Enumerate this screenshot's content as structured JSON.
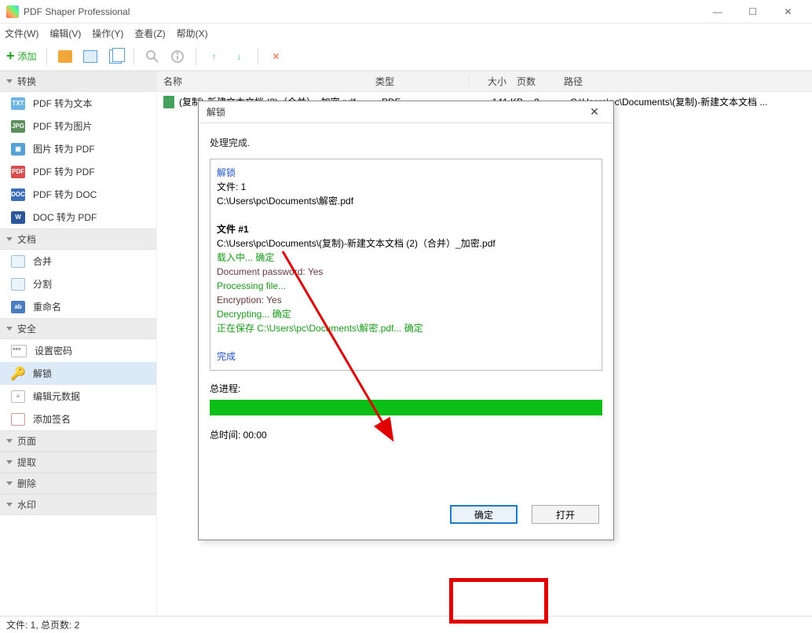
{
  "app": {
    "title": "PDF Shaper Professional"
  },
  "window": {
    "min": "—",
    "max": "☐",
    "close": "✕"
  },
  "menu": {
    "file": "文件(W)",
    "edit": "编辑(V)",
    "action": "操作(Y)",
    "view": "查看(Z)",
    "help": "帮助(X)"
  },
  "toolbar": {
    "add": "添加"
  },
  "sidebar": {
    "groups": {
      "convert": "转换",
      "document": "文档",
      "security": "安全",
      "page": "页面",
      "extract": "提取",
      "delete": "删除",
      "watermark": "水印"
    },
    "convert_items": [
      "PDF 转为文本",
      "PDF 转为图片",
      "图片 转为 PDF",
      "PDF 转为 PDF",
      "PDF 转为 DOC",
      "DOC 转为 PDF"
    ],
    "document_items": [
      "合并",
      "分割",
      "重命名"
    ],
    "security_items": [
      "设置密码",
      "解锁",
      "编辑元数据",
      "添加签名"
    ]
  },
  "columns": {
    "name": "名称",
    "type": "类型",
    "size": "大小",
    "pages": "页数",
    "path": "路径"
  },
  "row": {
    "name": "(复制)-新建文本文档 (2)（合并）_加密.pdf",
    "type": "PDF",
    "size": "141 KB",
    "pages": "2",
    "path": "C:\\Users\\pc\\Documents\\(复制)-新建文本文档 ..."
  },
  "dialog": {
    "title": "解锁",
    "done": "处理完成.",
    "l1": "解锁",
    "l2": "文件: 1",
    "l3": "C:\\Users\\pc\\Documents\\解密.pdf",
    "l4": "文件 #1",
    "l5": "C:\\Users\\pc\\Documents\\(复制)-新建文本文档 (2)（合并）_加密.pdf",
    "l6": "载入中... 确定",
    "l7": "Document password: Yes",
    "l8": "Processing file...",
    "l9": "Encryption: Yes",
    "l10": "Decrypting... 确定",
    "l11": "正在保存 C:\\Users\\pc\\Documents\\解密.pdf... 确定",
    "l12": "完成",
    "progress_label": "总进程:",
    "time_label": "总时间: 00:00",
    "ok": "确定",
    "open": "打开"
  },
  "status": {
    "text": "文件: 1, 总页数: 2"
  }
}
